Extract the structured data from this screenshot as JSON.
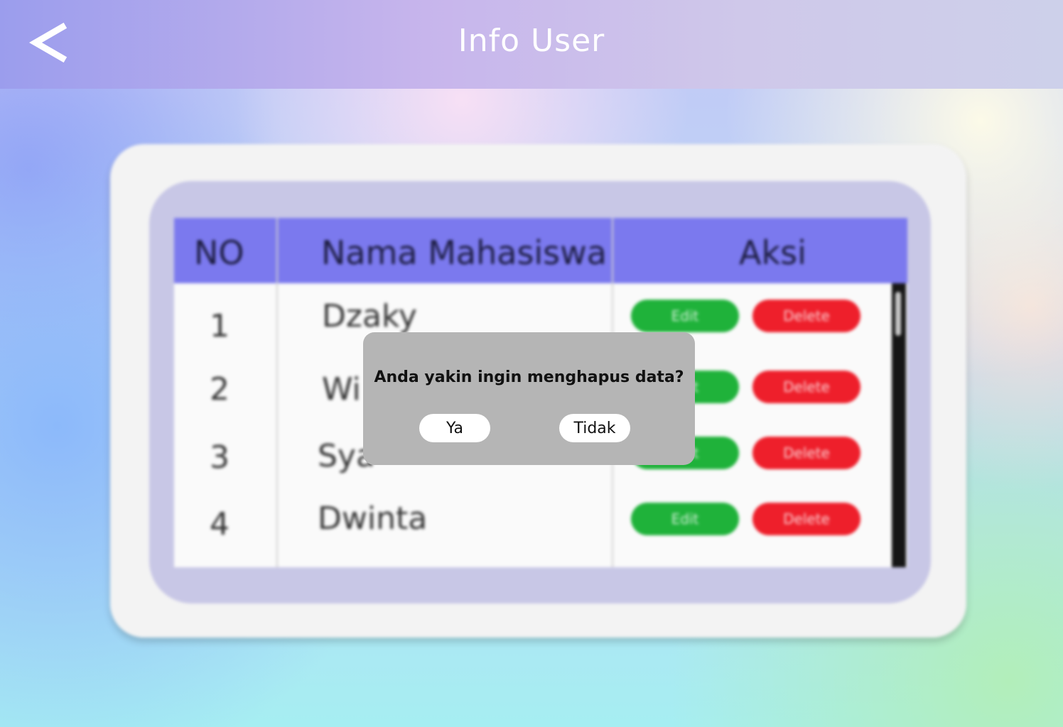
{
  "header": {
    "title": "Info User",
    "back_icon": "chevron-left-icon"
  },
  "table": {
    "columns": [
      "NO",
      "Nama Mahasiswa",
      "Aksi"
    ],
    "rows": [
      {
        "no": "1",
        "name": "Dzaky",
        "edit": "Edit",
        "delete": "Delete"
      },
      {
        "no": "2",
        "name": "Wi",
        "edit": "Edit",
        "delete": "Delete"
      },
      {
        "no": "3",
        "name": "Sya",
        "edit": "Edit",
        "delete": "Delete"
      },
      {
        "no": "4",
        "name": "Dwinta",
        "edit": "Edit",
        "delete": "Delete"
      }
    ]
  },
  "dialog": {
    "message": "Anda yakin ingin menghapus data?",
    "confirm_label": "Ya",
    "cancel_label": "Tidak"
  },
  "colors": {
    "table_header": "#7b79ee",
    "edit_button": "#1fb23a",
    "delete_button": "#ee1f2b",
    "dialog_background": "#b5b5b5"
  }
}
